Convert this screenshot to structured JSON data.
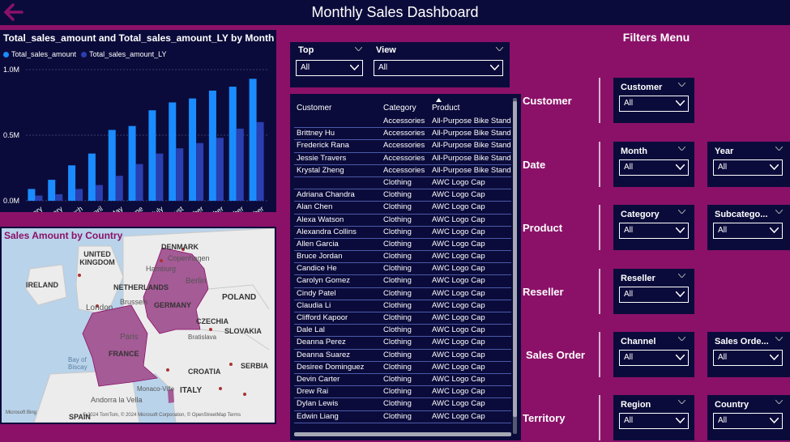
{
  "header": {
    "title": "Monthly Sales Dashboard",
    "back_icon": "back-arrow-icon"
  },
  "chart_data": {
    "type": "bar",
    "title": "Total_sales_amount and Total_sales_amount_LY by Month",
    "categories": [
      "January",
      "February",
      "March",
      "April",
      "May",
      "June",
      "July",
      "August",
      "September",
      "October",
      "November",
      "December"
    ],
    "series": [
      {
        "name": "Total_sales_amount",
        "color": "#1a8cff",
        "values": [
          0.09,
          0.16,
          0.27,
          0.36,
          0.54,
          0.57,
          0.69,
          0.75,
          0.78,
          0.84,
          0.87,
          0.93
        ]
      },
      {
        "name": "Total_sales_amount_LY",
        "color": "#2a3fb0",
        "values": [
          0.04,
          0.05,
          0.09,
          0.12,
          0.19,
          0.28,
          0.36,
          0.4,
          0.44,
          0.48,
          0.55,
          0.6
        ]
      }
    ],
    "y_ticks": [
      "0.0M",
      "0.5M",
      "1.0M"
    ],
    "ylim": [
      0,
      1.0
    ],
    "grid": true,
    "legend": "top-left"
  },
  "map": {
    "title": "Sales Amount by Country",
    "countries": [
      "DENMARK",
      "UNITED KINGDOM",
      "IRELAND",
      "NETHERLANDS",
      "GERMANY",
      "POLAND",
      "CZECHIA",
      "SLOVAKIA",
      "FRANCE",
      "CROATIA",
      "ITALY",
      "SERBIA",
      "SPAIN"
    ],
    "cities": [
      "Copenhagen",
      "Hamburg",
      "Berlin",
      "London",
      "Brussels",
      "Paris",
      "Bratislava",
      "Monaco-Ville",
      "Andorra la Vella"
    ],
    "water": [
      "Bay of Biscay"
    ],
    "attribution": "© 2024 TomTom, © 2024 Microsoft Corporation, © OpenStreetMap  Terms",
    "logo": "Microsoft Bing"
  },
  "top_slicers": {
    "top": {
      "label": "Top",
      "value": "All"
    },
    "view": {
      "label": "View",
      "value": "All"
    }
  },
  "table": {
    "headers": [
      "Customer",
      "Category",
      "Product"
    ],
    "rows": [
      [
        "",
        "Accessories",
        "All-Purpose Bike Stand"
      ],
      [
        "Brittney Hu",
        "Accessories",
        "All-Purpose Bike Stand"
      ],
      [
        "Frederick Rana",
        "Accessories",
        "All-Purpose Bike Stand"
      ],
      [
        "Jessie Travers",
        "Accessories",
        "All-Purpose Bike Stand"
      ],
      [
        "Krystal Zheng",
        "Accessories",
        "All-Purpose Bike Stand"
      ],
      [
        "",
        "Clothing",
        "AWC Logo Cap"
      ],
      [
        "Adriana Chandra",
        "Clothing",
        "AWC Logo Cap"
      ],
      [
        "Alan Chen",
        "Clothing",
        "AWC Logo Cap"
      ],
      [
        "Alexa Watson",
        "Clothing",
        "AWC Logo Cap"
      ],
      [
        "Alexandra Collins",
        "Clothing",
        "AWC Logo Cap"
      ],
      [
        "Allen Garcia",
        "Clothing",
        "AWC Logo Cap"
      ],
      [
        "Bruce Jordan",
        "Clothing",
        "AWC Logo Cap"
      ],
      [
        "Candice He",
        "Clothing",
        "AWC Logo Cap"
      ],
      [
        "Carolyn Gomez",
        "Clothing",
        "AWC Logo Cap"
      ],
      [
        "Cindy Patel",
        "Clothing",
        "AWC Logo Cap"
      ],
      [
        "Claudia Li",
        "Clothing",
        "AWC Logo Cap"
      ],
      [
        "Clifford Kapoor",
        "Clothing",
        "AWC Logo Cap"
      ],
      [
        "Dale Lal",
        "Clothing",
        "AWC Logo Cap"
      ],
      [
        "Deanna Perez",
        "Clothing",
        "AWC Logo Cap"
      ],
      [
        "Deanna Suarez",
        "Clothing",
        "AWC Logo Cap"
      ],
      [
        "Desiree Dominguez",
        "Clothing",
        "AWC Logo Cap"
      ],
      [
        "Devin Carter",
        "Clothing",
        "AWC Logo Cap"
      ],
      [
        "Drew Rai",
        "Clothing",
        "AWC Logo Cap"
      ],
      [
        "Dylan Lewis",
        "Clothing",
        "AWC Logo Cap"
      ],
      [
        "Edwin Liang",
        "Clothing",
        "AWC Logo Cap"
      ]
    ]
  },
  "filters": {
    "title": "Filters Menu",
    "customer": {
      "label": "Customer",
      "slicers": [
        {
          "label": "Customer",
          "value": "All"
        }
      ]
    },
    "date": {
      "label": "Date",
      "slicers": [
        {
          "label": "Month",
          "value": "All"
        },
        {
          "label": "Year",
          "value": "All"
        }
      ]
    },
    "product": {
      "label": "Product",
      "slicers": [
        {
          "label": "Category",
          "value": "All"
        },
        {
          "label": "Subcatego...",
          "value": "All"
        }
      ]
    },
    "reseller": {
      "label": "Reseller",
      "slicers": [
        {
          "label": "Reseller",
          "value": "All"
        }
      ]
    },
    "sales_order": {
      "label": "Sales Order",
      "slicers": [
        {
          "label": "Channel",
          "value": "All"
        },
        {
          "label": "Sales Orde...",
          "value": "All"
        }
      ]
    },
    "territory": {
      "label": "Territory",
      "slicers": [
        {
          "label": "Region",
          "value": "All"
        },
        {
          "label": "Country",
          "value": "All"
        }
      ]
    }
  }
}
